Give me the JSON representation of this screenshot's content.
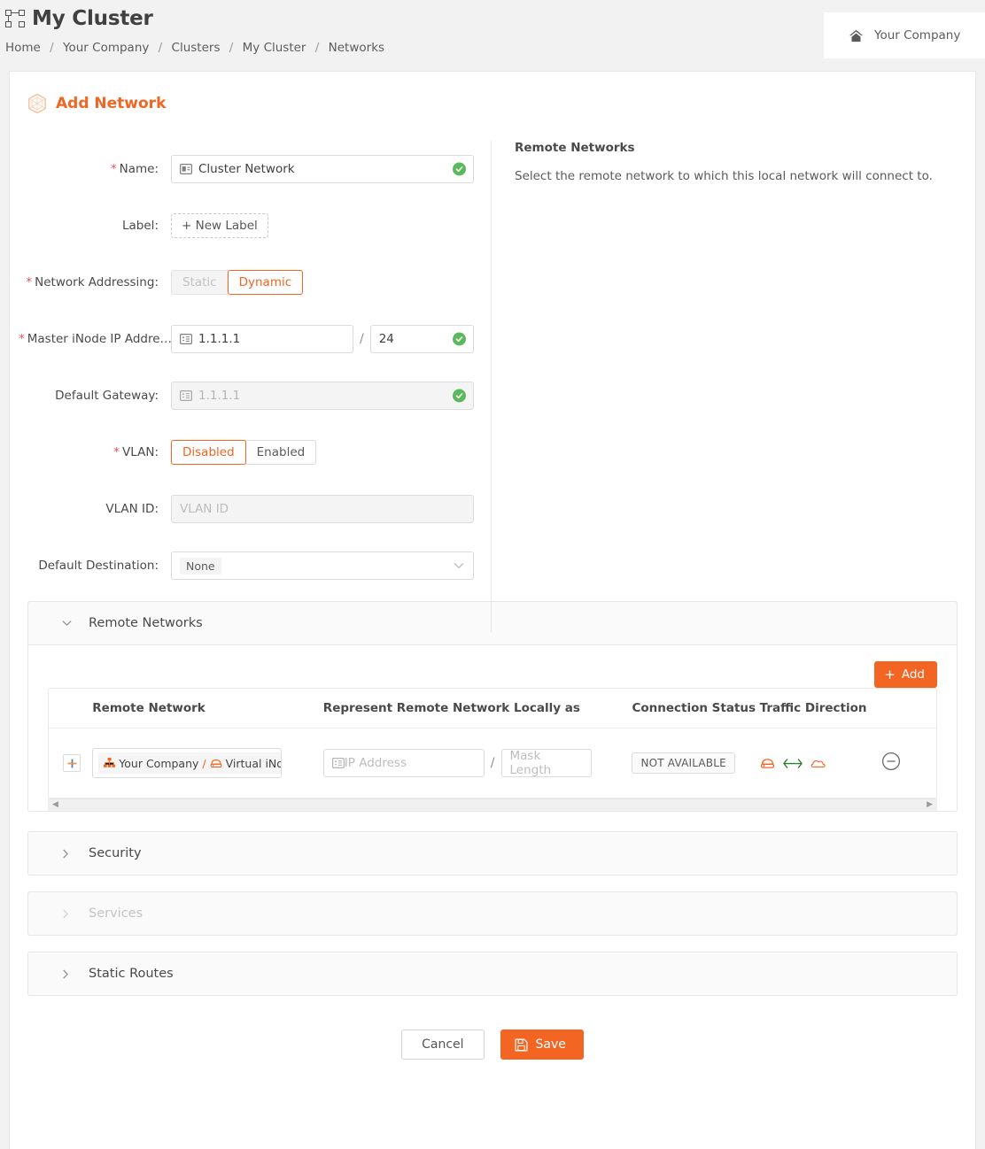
{
  "header": {
    "title": "My Cluster",
    "cluster_icon": "cluster-icon",
    "breadcrumb": [
      "Home",
      "Your Company",
      "Clusters",
      "My Cluster",
      "Networks"
    ],
    "breadcrumb_separator": "/",
    "company_chip": {
      "label": "Your Company",
      "icon": "home-icon"
    }
  },
  "card": {
    "icon": "hexagon-network-icon",
    "title": "Add Network"
  },
  "form": {
    "name": {
      "label": "Name",
      "required": true,
      "value": "Cluster Network",
      "icon": "name-card-icon",
      "valid": true
    },
    "label_field": {
      "label": "Label",
      "required": false,
      "button": "+ New Label"
    },
    "network_addressing": {
      "label": "Network Addressing",
      "required": true,
      "options": [
        "Static",
        "Dynamic"
      ],
      "selected": "Dynamic",
      "disabled_option": "Static"
    },
    "master_inode_ip": {
      "label": "Master iNode IP Addre…",
      "required": true,
      "ip_value": "1.1.1.1",
      "mask_value": "24",
      "separator": "/",
      "icon": "ip-address-icon",
      "valid": true
    },
    "default_gateway": {
      "label": "Default Gateway",
      "required": false,
      "value": "1.1.1.1",
      "icon": "ip-address-icon",
      "disabled": true,
      "valid": true
    },
    "vlan": {
      "label": "VLAN",
      "required": true,
      "options": [
        "Disabled",
        "Enabled"
      ],
      "selected": "Disabled"
    },
    "vlan_id": {
      "label": "VLAN ID",
      "required": false,
      "placeholder": "VLAN ID",
      "value": "",
      "disabled": true
    },
    "default_destination": {
      "label": "Default Destination",
      "required": false,
      "selected": "None",
      "caret": "chevron-down-icon"
    }
  },
  "side_panel": {
    "heading": "Remote Networks",
    "description": "Select the remote network to which this local network will connect to."
  },
  "sections": {
    "remote_networks": {
      "title": "Remote Networks",
      "expanded": true,
      "chevron": "chevron-down-icon",
      "add_button": {
        "label": "Add",
        "plus": "+"
      },
      "columns": [
        "Remote Network",
        "Represent Remote Network Locally as",
        "Connection Status",
        "Traffic Direction"
      ],
      "rows": [
        {
          "expand": "+",
          "remote_network_chip": {
            "parts": [
              "Your Company",
              "Virtual iNode",
              ""
            ],
            "separator": "/",
            "icons": [
              "org-tree-icon",
              "inode-icon",
              "network-hexagon-icon"
            ]
          },
          "local_ip_placeholder": "IP Address",
          "local_ip_value": "",
          "mask_placeholder": "Mask Length",
          "mask_value": "",
          "separator": "/",
          "connection_status": "NOT AVAILABLE",
          "traffic_direction": [
            "inode-icon",
            "bidirectional-arrow-icon",
            "cloud-icon"
          ],
          "remove": "remove-circle-icon"
        }
      ],
      "scrollbar": {
        "left_arrow": "◀",
        "right_arrow": "▶"
      }
    },
    "security": {
      "title": "Security",
      "expanded": false,
      "chevron": "chevron-right-icon",
      "disabled": false
    },
    "services": {
      "title": "Services",
      "expanded": false,
      "chevron": "chevron-right-icon",
      "disabled": true
    },
    "static_routes": {
      "title": "Static Routes",
      "expanded": false,
      "chevron": "chevron-right-icon",
      "disabled": false
    }
  },
  "footer": {
    "cancel": "Cancel",
    "save": "Save",
    "save_icon": "save-disk-icon"
  },
  "colors": {
    "accent": "#f26522",
    "required": "#e8505b",
    "valid": "#5cb85c",
    "text": "#4a4a4a",
    "muted": "#bdbdbd",
    "arrow_green": "#2e7d32"
  }
}
